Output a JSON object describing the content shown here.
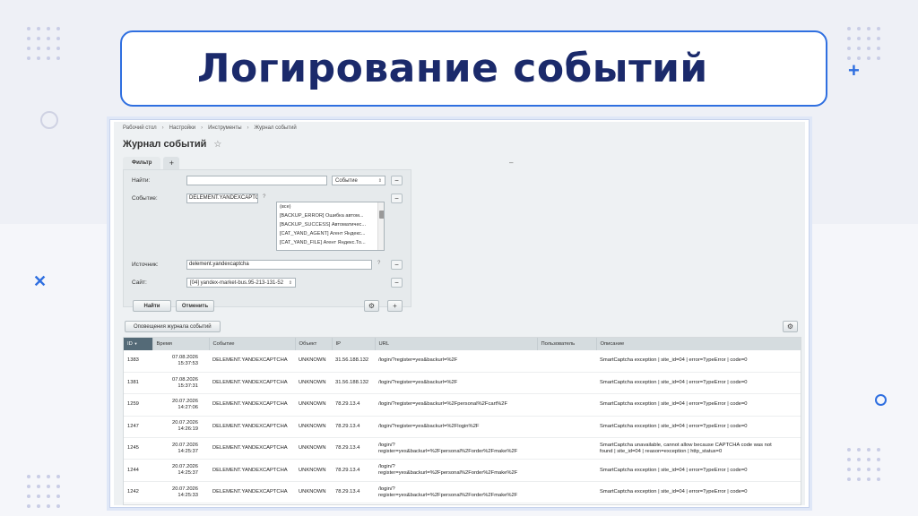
{
  "slide": {
    "title": "Логирование событий"
  },
  "app": {
    "breadcrumb": [
      "Рабочий стол",
      "Настройки",
      "Инструменты",
      "Журнал событий"
    ],
    "breadcrumb_sep": "›",
    "page_title": "Журнал событий",
    "star_icon": "☆"
  },
  "filter": {
    "tab_label": "Фильтр",
    "add_tab": "+",
    "collapse": "–",
    "find_label": "Найти:",
    "find_value": "",
    "find_select": "Событие",
    "event_label": "Событие:",
    "event_value": "DELEMENT.YANDEXCAPTCHA",
    "event_hint": "?",
    "event_options": [
      "(все)",
      "[BACKUP_ERROR] Ошибка автом...",
      "[BACKUP_SUCCESS] Автоматичес...",
      "[CAT_YAND_AGENT] Агент Яндекс...",
      "[CAT_YAND_FILE] Агент Яндекс.То..."
    ],
    "source_label": "Источник:",
    "source_value": "delement.yandexcaptcha",
    "source_hint": "?",
    "site_label": "Сайт:",
    "site_value": "[04] yandex-market-bus.95-213-131-52",
    "minus": "−",
    "find_button": "Найти",
    "cancel_button": "Отменить",
    "gear_icon": "⚙",
    "plus_icon": "+"
  },
  "toolbar": {
    "notifications_button": "Оповещения журнала событий",
    "settings_icon": "⚙"
  },
  "table": {
    "columns": [
      "ID",
      "Время",
      "Событие",
      "Объект",
      "IP",
      "URL",
      "Пользователь",
      "Описание"
    ],
    "sort_icon": "▼",
    "rows": [
      {
        "id": "1383",
        "date": "07.08.2026",
        "time": "15:37:53",
        "event": "DELEMENT.YANDEXCAPTCHA",
        "object": "UNKNOWN",
        "ip": "31.56.188.132",
        "url": "/login/?register=yes&backurl=%2F",
        "user": "",
        "desc": "SmartCaptcha exception | site_id=04 | error=TypeError | code=0"
      },
      {
        "id": "1381",
        "date": "07.08.2026",
        "time": "15:37:31",
        "event": "DELEMENT.YANDEXCAPTCHA",
        "object": "UNKNOWN",
        "ip": "31.56.188.132",
        "url": "/login/?register=yes&backurl=%2F",
        "user": "",
        "desc": "SmartCaptcha exception | site_id=04 | error=TypeError | code=0"
      },
      {
        "id": "1259",
        "date": "20.07.2026",
        "time": "14:27:06",
        "event": "DELEMENT.YANDEXCAPTCHA",
        "object": "UNKNOWN",
        "ip": "78.29.13.4",
        "url": "/login/?register=yes&backurl=%2Fpersonal%2Fcart%2F",
        "user": "",
        "desc": "SmartCaptcha exception | site_id=04 | error=TypeError | code=0"
      },
      {
        "id": "1247",
        "date": "20.07.2026",
        "time": "14:26:19",
        "event": "DELEMENT.YANDEXCAPTCHA",
        "object": "UNKNOWN",
        "ip": "78.29.13.4",
        "url": "/login/?register=yes&backurl=%2Flogin%2F",
        "user": "",
        "desc": "SmartCaptcha exception | site_id=04 | error=TypeError | code=0"
      },
      {
        "id": "1245",
        "date": "20.07.2026",
        "time": "14:25:37",
        "event": "DELEMENT.YANDEXCAPTCHA",
        "object": "UNKNOWN",
        "ip": "78.29.13.4",
        "url": "/login/?",
        "url2": "register=yes&backurl=%2Fpersonal%2Forder%2Fmake%2F",
        "user": "",
        "desc": "SmartCaptcha unavailable, cannot allow because CAPTCHA code was not",
        "desc2": "found | site_id=04 | reason=exception | http_status=0"
      },
      {
        "id": "1244",
        "date": "20.07.2026",
        "time": "14:25:37",
        "event": "DELEMENT.YANDEXCAPTCHA",
        "object": "UNKNOWN",
        "ip": "78.29.13.4",
        "url": "/login/?",
        "url2": "register=yes&backurl=%2Fpersonal%2Forder%2Fmake%2F",
        "user": "",
        "desc": "SmartCaptcha exception | site_id=04 | error=TypeError | code=0"
      },
      {
        "id": "1242",
        "date": "20.07.2026",
        "time": "14:25:33",
        "event": "DELEMENT.YANDEXCAPTCHA",
        "object": "UNKNOWN",
        "ip": "78.29.13.4",
        "url": "/login/?",
        "url2": "register=yes&backurl=%2Fpersonal%2Forder%2Fmake%2F",
        "user": "",
        "desc": "SmartCaptcha exception | site_id=04 | error=TypeError | code=0"
      }
    ]
  },
  "colors": {
    "accent": "#2f6fe0",
    "title_text": "#1b2a6b",
    "header_active": "#546a77"
  },
  "decor": {
    "plus_icon": "+",
    "x_icon": "✕"
  }
}
